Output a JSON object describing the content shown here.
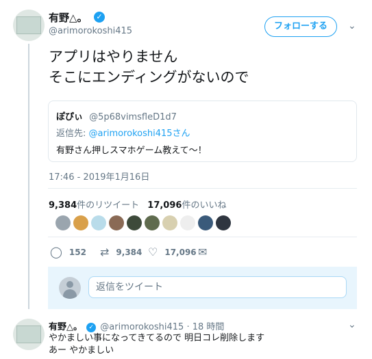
{
  "main_tweet": {
    "author_name": "有野△。",
    "author_handle": "@arimorokoshi415",
    "follow_label": "フォローする",
    "text": "アプリはやりません\nそこにエンディングがないので",
    "quoted": {
      "name": "ぽぴぃ",
      "handle": "@5p68vimsfleD1d7",
      "reply_prefix": "返信先: ",
      "reply_to": "@arimorokoshi415",
      "reply_suffix": "さん",
      "text": "有野さん押しスマホゲーム教えて〜！"
    },
    "timestamp": "17:46 - 2019年1月16日",
    "retweet_count": "9,384",
    "retweet_label": "件のリツイート",
    "like_count": "17,096",
    "like_label": "件のいいね",
    "actions": {
      "replies": "152",
      "retweets": "9,384",
      "likes": "17,096"
    },
    "likers": [
      "#9aa5ae",
      "#d9a04a",
      "#b9dcea",
      "#8a6a55",
      "#3d4a3a",
      "#5f6b4e",
      "#d8d0b0",
      "#eeeeee",
      "#3a5a7a",
      "#2f3640"
    ]
  },
  "reply_box": {
    "placeholder": "返信をツイート"
  },
  "reply_tweet": {
    "author_name": "有野△。",
    "author_handle": "@arimorokoshi415",
    "time_sep": "·",
    "time": "18 時間",
    "text": "やかましい事になってきてるので 明日コレ削除します\nあー やかましい"
  }
}
